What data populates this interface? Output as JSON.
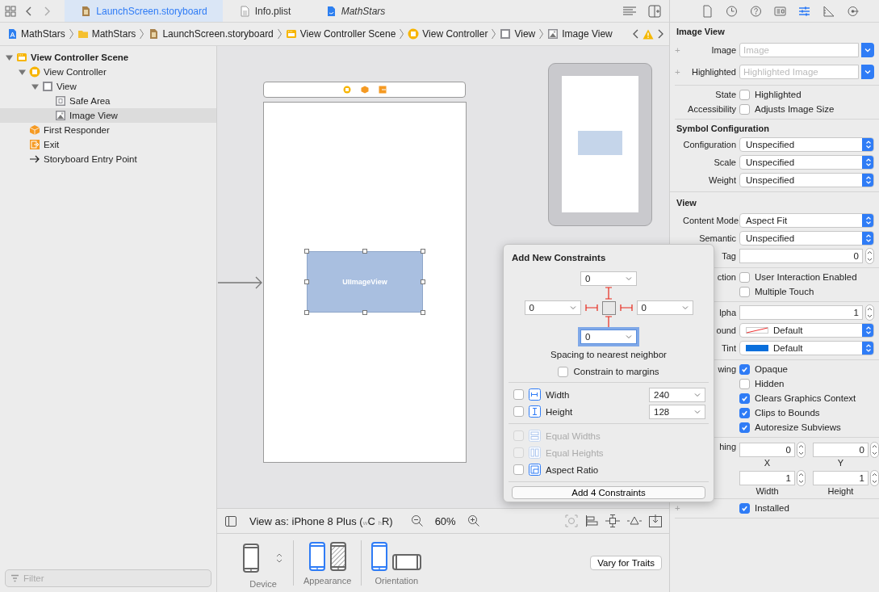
{
  "tabs": [
    {
      "label": "LaunchScreen.storyboard",
      "kind": "storyboard",
      "selected": true,
      "preview": false
    },
    {
      "label": "Info.plist",
      "kind": "plist",
      "selected": false,
      "preview": false
    },
    {
      "label": "MathStars",
      "kind": "swift",
      "selected": false,
      "preview": true
    }
  ],
  "breadcrumb": [
    {
      "label": "MathStars",
      "kind": "project"
    },
    {
      "label": "MathStars",
      "kind": "folder"
    },
    {
      "label": "LaunchScreen.storyboard",
      "kind": "storyboard"
    },
    {
      "label": "View Controller Scene",
      "kind": "scene"
    },
    {
      "label": "View Controller",
      "kind": "controller"
    },
    {
      "label": "View",
      "kind": "view"
    },
    {
      "label": "Image View",
      "kind": "image-view"
    }
  ],
  "outline": {
    "items": [
      {
        "label": "View Controller Scene",
        "kind": "scene",
        "expanded": true,
        "selected": false,
        "children": [
          {
            "label": "View Controller",
            "kind": "controller",
            "expanded": true,
            "selected": false,
            "children": [
              {
                "label": "View",
                "kind": "view",
                "expanded": true,
                "selected": false,
                "children": [
                  {
                    "label": "Safe Area",
                    "kind": "safe-area",
                    "selected": false
                  },
                  {
                    "label": "Image View",
                    "kind": "image-view",
                    "selected": true
                  }
                ]
              }
            ]
          },
          {
            "label": "First Responder",
            "kind": "responder",
            "selected": false
          },
          {
            "label": "Exit",
            "kind": "exit",
            "selected": false
          },
          {
            "label": "Storyboard Entry Point",
            "kind": "entry",
            "selected": false
          }
        ]
      }
    ],
    "filter": {
      "placeholder": "Filter"
    }
  },
  "canvas": {
    "image_view_label": "UIImageView"
  },
  "view_bar": {
    "view_as": "View as: iPhone 8 Plus ($_{w}$C $_{h}$R)",
    "zoom": "60%"
  },
  "device_bar": {
    "groups": [
      {
        "kind": "device",
        "label": "Device",
        "options": [
          {
            "kind": "phone",
            "selected": false
          }
        ]
      },
      {
        "kind": "appearance",
        "label": "Appearance",
        "options": [
          {
            "kind": "light",
            "selected": true
          },
          {
            "kind": "dark",
            "selected": false
          }
        ]
      },
      {
        "kind": "orientation",
        "label": "Orientation",
        "options": [
          {
            "kind": "portrait",
            "selected": true
          },
          {
            "kind": "landscape",
            "selected": false
          }
        ]
      }
    ],
    "vary_button": "Vary for Traits"
  },
  "constraints_popover": {
    "title": "Add New Constraints",
    "spacing": [
      {
        "value": "0",
        "focused": false
      },
      {
        "value": "0",
        "focused": false
      },
      {
        "value": "0",
        "focused": false
      },
      {
        "value": "0",
        "focused": true
      }
    ],
    "caption": "Spacing to nearest neighbor",
    "margins": {
      "label": "Constrain to margins",
      "checked": false
    },
    "sizes": [
      {
        "kind": "width",
        "label": "Width",
        "checked": false,
        "value": "240"
      },
      {
        "kind": "height",
        "label": "Height",
        "checked": false,
        "value": "128"
      }
    ],
    "relations": [
      {
        "kind": "equal-widths",
        "label": "Equal Widths",
        "checked": false,
        "disabled": true
      },
      {
        "kind": "equal-heights",
        "label": "Equal Heights",
        "checked": false,
        "disabled": true
      },
      {
        "kind": "aspect",
        "label": "Aspect Ratio",
        "checked": false,
        "disabled": false
      }
    ],
    "button": "Add 4 Constraints"
  },
  "inspector": {
    "tabs": [
      {
        "kind": "file",
        "selected": false
      },
      {
        "kind": "history",
        "selected": false
      },
      {
        "kind": "help",
        "selected": false
      },
      {
        "kind": "identity",
        "selected": false
      },
      {
        "kind": "attributes",
        "selected": true
      },
      {
        "kind": "size",
        "selected": false
      },
      {
        "kind": "connections",
        "selected": false
      }
    ],
    "sections": [
      {
        "title": "Image View",
        "rows": [
          {
            "kind": "combo",
            "prefix": "+",
            "label": "Image",
            "placeholder": "Image"
          },
          {
            "kind": "combo",
            "prefix": "+",
            "label": "Highlighted",
            "placeholder": "Highlighted Image"
          }
        ]
      },
      {
        "rows": [
          {
            "kind": "check",
            "label": "State",
            "option": "Highlighted",
            "checked": false
          },
          {
            "kind": "check",
            "label": "Accessibility",
            "option": "Adjusts Image Size",
            "checked": false
          }
        ]
      },
      {
        "title": "Symbol Configuration",
        "rows": [
          {
            "kind": "popup",
            "label": "Configuration",
            "value": "Unspecified"
          },
          {
            "kind": "popup",
            "label": "Scale",
            "value": "Unspecified"
          },
          {
            "kind": "popup",
            "label": "Weight",
            "value": "Unspecified"
          }
        ]
      },
      {
        "title": "View",
        "rows": [
          {
            "kind": "popup",
            "label": "Content Mode",
            "value": "Aspect Fit"
          },
          {
            "kind": "popup",
            "label": "Semantic",
            "value": "Unspecified"
          },
          {
            "kind": "stepper",
            "label": "Tag",
            "value": "0"
          }
        ]
      },
      {
        "rows": [
          {
            "kind": "check",
            "label": "ction",
            "option": "User Interaction Enabled",
            "checked": false
          },
          {
            "kind": "check",
            "option": "Multiple Touch",
            "checked": false
          }
        ]
      },
      {
        "rows": [
          {
            "kind": "stepper",
            "label": "lpha",
            "value": "1"
          },
          {
            "kind": "color",
            "label": "ound",
            "value": "Default"
          },
          {
            "kind": "color",
            "label": "Tint",
            "value": "Default",
            "color": "#0a6fdc"
          }
        ]
      },
      {
        "rows": [
          {
            "kind": "check",
            "label": "wing",
            "option": "Opaque",
            "checked": true
          },
          {
            "kind": "check",
            "option": "Hidden",
            "checked": false
          },
          {
            "kind": "check",
            "option": "Clears Graphics Context",
            "checked": true
          },
          {
            "kind": "check",
            "option": "Clips to Bounds",
            "checked": true
          },
          {
            "kind": "check",
            "option": "Autoresize Subviews",
            "checked": true
          }
        ]
      },
      {
        "rows": [
          {
            "kind": "pair",
            "label": "hing",
            "fields": [
              {
                "value": "0",
                "caption": "X"
              },
              {
                "value": "0",
                "caption": "Y"
              }
            ]
          },
          {
            "kind": "pair",
            "fields": [
              {
                "value": "1",
                "caption": "Width"
              },
              {
                "value": "1",
                "caption": "Height"
              }
            ]
          }
        ]
      },
      {
        "rows": [
          {
            "kind": "check",
            "prefix": "+",
            "option": "Installed",
            "checked": true
          }
        ]
      }
    ]
  }
}
